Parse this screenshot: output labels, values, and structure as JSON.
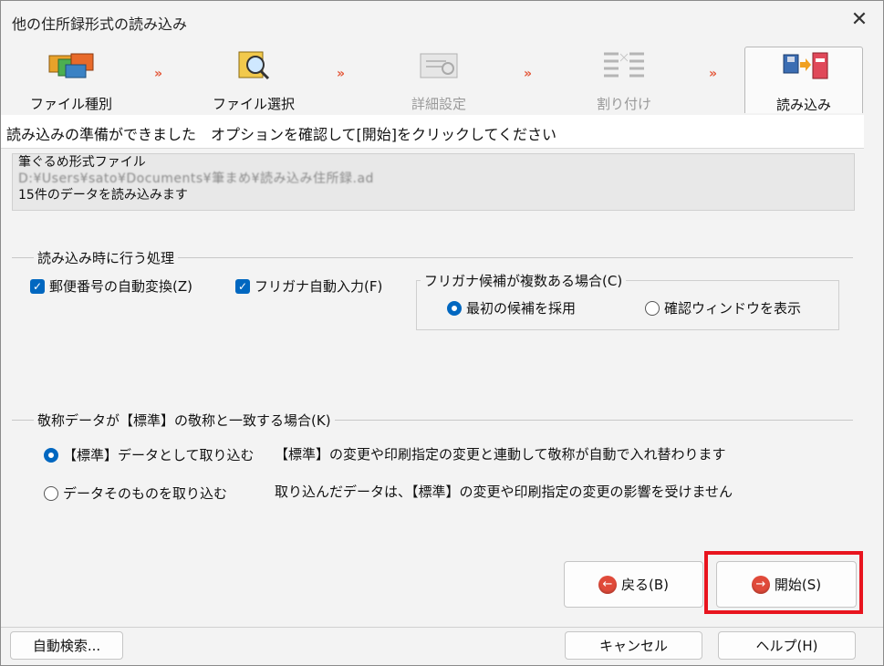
{
  "window": {
    "title": "他の住所録形式の読み込み",
    "close_label": "✕"
  },
  "steps": [
    {
      "label": "ファイル種別",
      "icon": "folders-icon",
      "state": "done"
    },
    {
      "label": "ファイル選択",
      "icon": "folder-search-icon",
      "state": "done"
    },
    {
      "label": "詳細設定",
      "icon": "settings-document-icon",
      "state": "disabled"
    },
    {
      "label": "割り付け",
      "icon": "mapping-list-icon",
      "state": "disabled"
    },
    {
      "label": "読み込み",
      "icon": "import-notebook-icon",
      "state": "active"
    }
  ],
  "step_arrow": "»",
  "banner": {
    "message": "読み込みの準備ができました　オプションを確認して[開始]をクリックしてください"
  },
  "file_info": {
    "format": "筆ぐるめ形式ファイル",
    "path": "D:¥Users¥sato¥Documents¥筆まめ¥読み込み住所録.ad",
    "count_text": "15件のデータを読み込みます"
  },
  "import_options": {
    "section_title": "読み込み時に行う処理",
    "postal_checkbox": {
      "label": "郵便番号の自動変換(Z)",
      "checked": true
    },
    "furigana_checkbox": {
      "label": "フリガナ自動入力(F)",
      "checked": true
    },
    "furigana_group": {
      "title": "フリガナ候補が複数ある場合(C)",
      "option_first": "最初の候補を採用",
      "option_confirm": "確認ウィンドウを表示",
      "selected": "first"
    }
  },
  "honorific": {
    "section_title": "敬称データが【標準】の敬称と一致する場合(K)",
    "option_standard": "【標準】データとして取り込む",
    "option_standard_desc": "【標準】の変更や印刷指定の変更と連動して敬称が自動で入れ替わります",
    "option_asis": "データそのものを取り込む",
    "option_asis_desc": "取り込んだデータは、【標準】の変更や印刷指定の変更の影響を受けません",
    "selected": "standard"
  },
  "buttons": {
    "back": "戻る(B)",
    "start": "開始(S)",
    "auto_search": "自動検索...",
    "cancel": "キャンセル",
    "help": "ヘルプ(H)"
  },
  "colors": {
    "accent": "#0067c0",
    "highlight": "#e8141e",
    "arrow": "#e45a3c"
  }
}
